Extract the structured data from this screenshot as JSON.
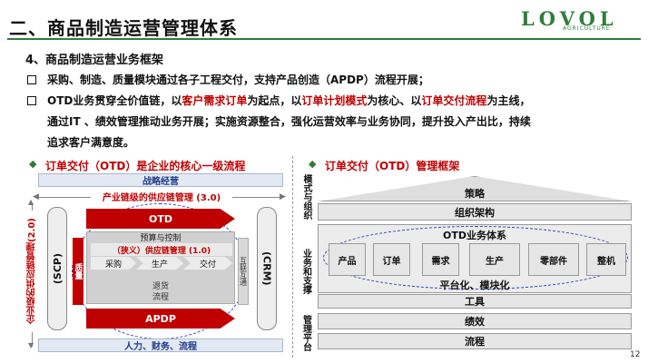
{
  "header": {
    "title": "二、商品制造运营管理体系",
    "logo_text": "LOVOL",
    "logo_sub": "AGRICULTURE"
  },
  "body": {
    "subheading": "4、商品制造运营业务框架",
    "bullet1": "采购、制造、质量模块通过各子工程交付，支持产品创造（APDP）流程开展；",
    "bullet2_a": "OTD业务贯穿全价值链，以",
    "bullet2_r1": "客户需求订单",
    "bullet2_b": "为起点，以",
    "bullet2_r2": "订单计划模式",
    "bullet2_c": "为核心、以",
    "bullet2_r3": "订单交付流程",
    "bullet2_d": "为主线，",
    "bullet2_line2": "通过IT 、绩效管理推动业务开展；实施资源整合，强化运营效率与业务协同，提升投入产出比，持续",
    "bullet2_line3": "追求客户满意度。"
  },
  "left_panel": {
    "title": "订单交付（OTD）是企业的核心一级流程",
    "strategy": "战略经营",
    "industry_chain": "产业链级的供应链管理 (3.0)",
    "enterprise_chain": "企业级的供应链管理(2.0)",
    "scp": "(SCP)",
    "crm": "(CRM)",
    "quality": "质量",
    "interaction": "互联互通",
    "otd": "OTD",
    "budget": "预算与控制",
    "narrow_chain": "（狭义）供应链管理 (1.0)",
    "purchase": "采购",
    "produce": "生产",
    "deliver": "交付",
    "return": "退货",
    "flow": "流程",
    "apdp": "APDP",
    "bottom": "人力、财务、流程"
  },
  "right_panel": {
    "title": "订单交付（OTD）管理框架",
    "side_model": "模式与组织",
    "side_business": "业务和支撑",
    "side_management": "管理平台",
    "strategy": "策略",
    "org": "组织架构",
    "otd_system": "OTD业务体系",
    "modules": [
      "产品",
      "订单",
      "需求",
      "生产",
      "零部件",
      "整机"
    ],
    "platform": "平台化、模块化",
    "tools": "工具",
    "performance": "绩效",
    "process": "流程"
  },
  "footer": {
    "page_number": "12"
  }
}
